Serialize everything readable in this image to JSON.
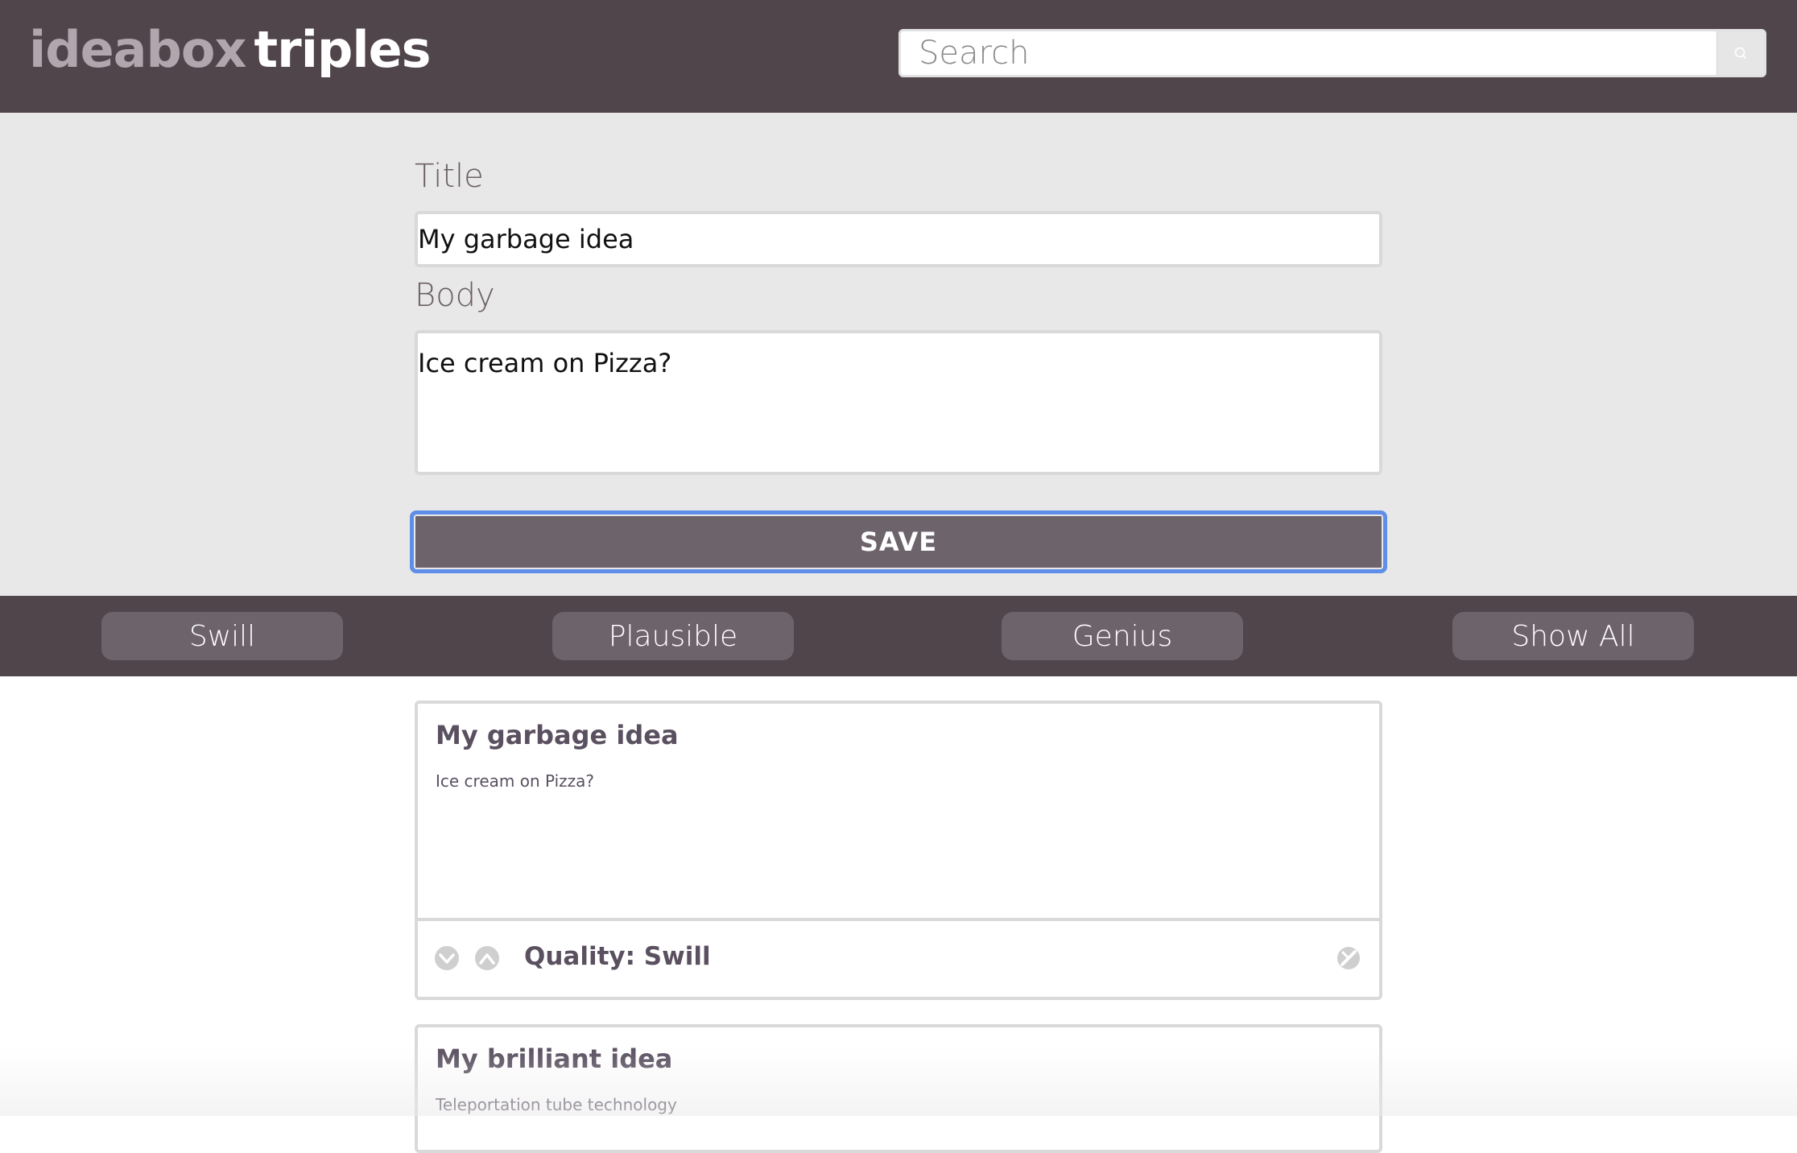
{
  "app": {
    "logo_light": "ideabox",
    "logo_strong": "triples"
  },
  "search": {
    "placeholder": "Search",
    "value": "",
    "icon": "search-icon"
  },
  "form": {
    "title_label": "Title",
    "title_value": "My garbage idea",
    "body_label": "Body",
    "body_value": "Ice cream on Pizza?",
    "save_label": "SAVE"
  },
  "filters": {
    "swill": "Swill",
    "plausible": "Plausible",
    "genius": "Genius",
    "show_all": "Show All"
  },
  "ideas": [
    {
      "title": "My garbage idea",
      "body": "Ice cream on Pizza?",
      "quality": "Quality: Swill",
      "icons": [
        "downvote-icon",
        "upvote-icon",
        "delete-icon"
      ]
    },
    {
      "title": "My brilliant idea",
      "body": "Teleportation tube technology"
    }
  ],
  "colors": {
    "header_bg": "#50454b",
    "button_bg": "#6d636b",
    "form_bg": "#e8e8e8",
    "logo_light": "#b2a6ae",
    "focus_ring": "#5f8ee8"
  }
}
